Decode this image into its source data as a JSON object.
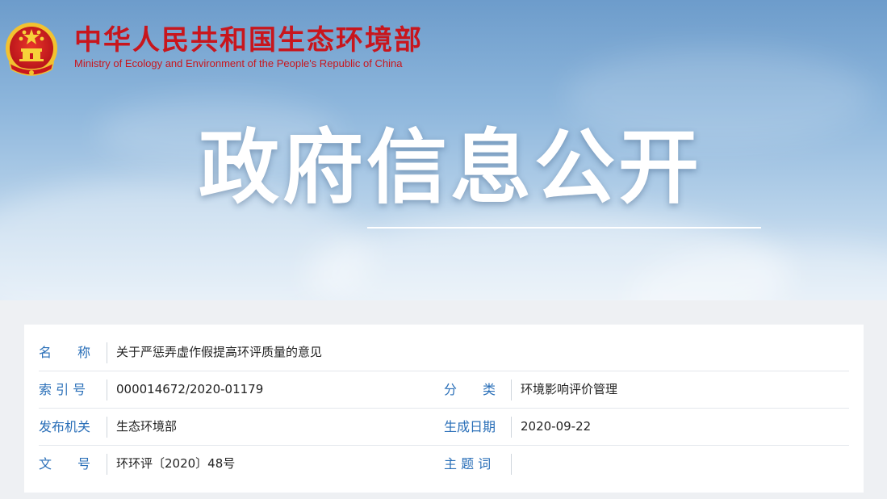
{
  "header": {
    "org_name_cn": "中华人民共和国生态环境部",
    "org_name_en": "Ministry of Ecology and Environment of the People's Republic of China",
    "emblem_icon": "national-emblem-icon",
    "banner_title": "政府信息公开"
  },
  "info": {
    "rows": [
      {
        "label": "名　　称",
        "value": "关于严惩弄虚作假提高环评质量的意见"
      },
      {
        "label": "索 引 号",
        "value": "000014672/2020-01179",
        "label2": "分　　类",
        "value2": "环境影响评价管理"
      },
      {
        "label": "发布机关",
        "value": "生态环境部",
        "label2": "生成日期",
        "value2": "2020-09-22"
      },
      {
        "label": "文　　号",
        "value": "环环评〔2020〕48号",
        "label2": "主 题 词",
        "value2": ""
      }
    ]
  },
  "colors": {
    "brand_red": "#c8161d",
    "label_blue": "#2a6fb8"
  }
}
